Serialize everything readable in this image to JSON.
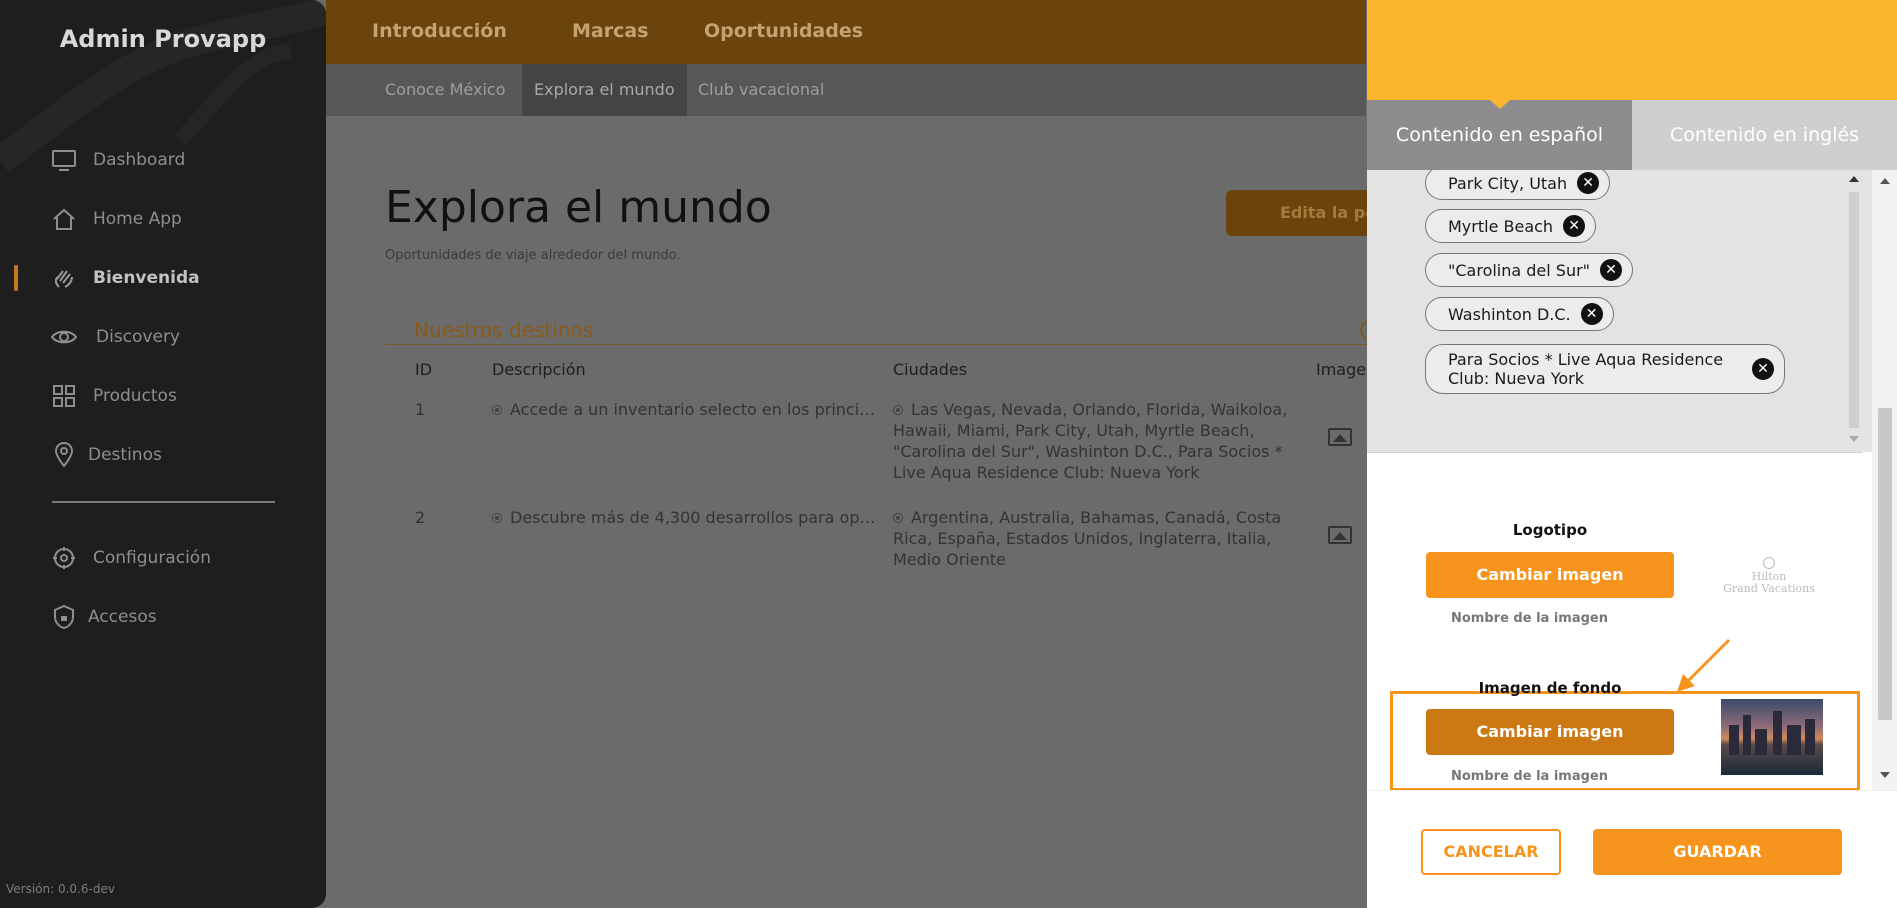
{
  "app": {
    "title": "Admin Provapp",
    "version": "Versión: 0.0.6-dev"
  },
  "sidebar": {
    "items": [
      {
        "label": "Dashboard",
        "icon": "monitor-icon"
      },
      {
        "label": "Home App",
        "icon": "home-icon"
      },
      {
        "label": "Bienvenida",
        "icon": "wave-hand-icon",
        "active": true
      },
      {
        "label": "Discovery",
        "icon": "eye-icon"
      },
      {
        "label": "Productos",
        "icon": "grid-icon"
      },
      {
        "label": "Destinos",
        "icon": "map-pin-icon"
      },
      {
        "label": "Configuración",
        "icon": "gear-icon"
      },
      {
        "label": "Accesos",
        "icon": "shield-lock-icon"
      }
    ]
  },
  "topnav": {
    "tabs": [
      "Introducción",
      "Marcas",
      "Oportunidades"
    ]
  },
  "subnav": {
    "tabs": [
      "Conoce México",
      "Explora el mundo",
      "Club vacacional"
    ]
  },
  "main": {
    "title": "Explora el mundo",
    "subtitle": "Oportunidades de viaje alrededor del mundo.",
    "edit_button": "Edita la po",
    "section_title": "Nuestros destinos",
    "table": {
      "headers": [
        "ID",
        "Descripción",
        "Ciudades",
        "Imagen"
      ],
      "rows": [
        {
          "id": "1",
          "desc": "Accede a un inventario selecto en los princi…",
          "cities": "Las Vegas, Nevada, Orlando, Florida, Waikoloa, Hawaii, Miami, Park City, Utah, Myrtle Beach, \"Carolina del Sur\", Washinton D.C., Para Socios * Live Aqua Residence Club: Nueva York"
        },
        {
          "id": "2",
          "desc": "Descubre más de 4,300 desarrollos para op…",
          "cities": "Argentina, Australia, Bahamas, Canadá, Costa Rica, España, Estados Unidos, Inglaterra, Italia, Medio Oriente"
        }
      ]
    }
  },
  "panel": {
    "tabs": {
      "es": "Contenido en español",
      "en": "Contenido en inglés"
    },
    "tags": [
      "Park City, Utah",
      "Myrtle Beach",
      "\"Carolina del Sur\"",
      "Washinton D.C.",
      "Para Socios * Live Aqua Residence Club: Nueva York"
    ],
    "remove_glyph": "✕",
    "logo": {
      "label": "Logotipo",
      "button": "Cambiar imagen",
      "hint": "Nombre de la imagen",
      "preview_line1": "Hilton",
      "preview_line2": "Grand Vacations"
    },
    "background": {
      "label": "Imagen de fondo",
      "button": "Cambiar imagen",
      "hint": "Nombre de la imagen"
    },
    "cancel": "CANCELAR",
    "save": "GUARDAR"
  },
  "colors": {
    "accent": "#f7941d",
    "panel_header": "#fbb62d",
    "sidebar": "#1e1e1e"
  }
}
